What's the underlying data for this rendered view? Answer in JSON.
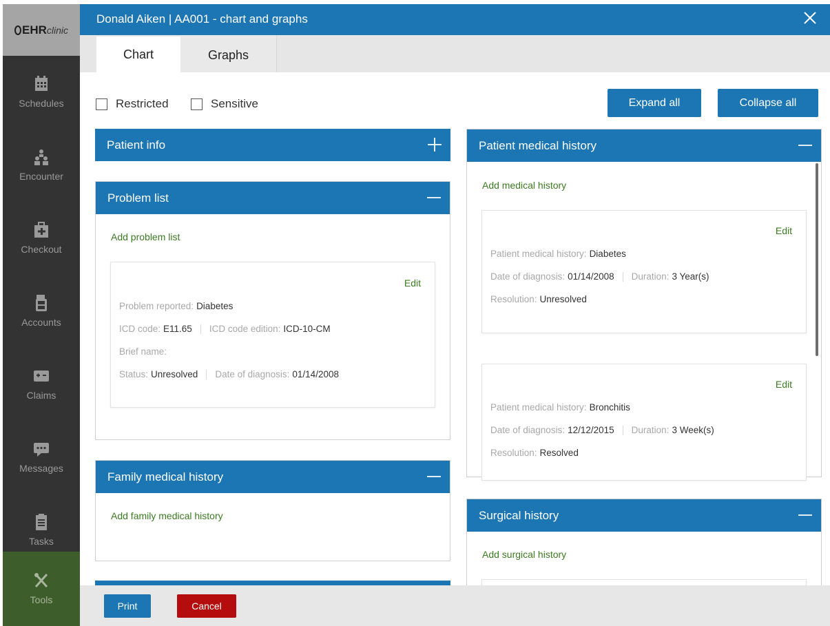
{
  "sidebar": {
    "logo": {
      "brand": "EHR",
      "suffix": "clinic"
    },
    "items": [
      {
        "label": "Schedules",
        "icon": "calendar-icon"
      },
      {
        "label": "Encounter",
        "icon": "users-icon"
      },
      {
        "label": "Checkout",
        "icon": "medical-bag-icon"
      },
      {
        "label": "Accounts",
        "icon": "calculator-icon"
      },
      {
        "label": "Claims",
        "icon": "claims-card-icon"
      },
      {
        "label": "Messages",
        "icon": "chat-bubble-icon"
      },
      {
        "label": "Tasks",
        "icon": "clipboard-icon"
      },
      {
        "label": "Tools",
        "icon": "tools-icon",
        "active": true
      }
    ]
  },
  "header": {
    "title": "Donald Aiken | AA001 - chart and graphs",
    "close_icon": "close-icon"
  },
  "tabs": [
    {
      "label": "Chart",
      "active": true
    },
    {
      "label": "Graphs",
      "active": false
    }
  ],
  "filters": {
    "restricted": "Restricted",
    "sensitive": "Sensitive"
  },
  "actions": {
    "expand_all": "Expand all",
    "collapse_all": "Collapse all"
  },
  "patient_info": {
    "title": "Patient info"
  },
  "problem_list": {
    "title": "Problem list",
    "add_link": "Add problem list",
    "card": {
      "edit": "Edit",
      "problem_reported_label": "Problem reported:",
      "problem_reported": "Diabetes",
      "icd_code_label": "ICD code:",
      "icd_code": "E11.65",
      "icd_edition_label": "ICD code edition:",
      "icd_edition": "ICD-10-CM",
      "brief_name_label": "Brief name:",
      "status_label": "Status:",
      "status": "Unresolved",
      "date_label": "Date of diagnosis:",
      "date": "01/14/2008"
    }
  },
  "family_history": {
    "title": "Family medical history",
    "add_link": "Add family medical history"
  },
  "medical_history": {
    "title": "Patient medical history",
    "add_link": "Add medical history",
    "cards": [
      {
        "edit": "Edit",
        "history_label": "Patient medical history:",
        "history": "Diabetes",
        "date_label": "Date of diagnosis:",
        "date": "01/14/2008",
        "duration_label": "Duration:",
        "duration": "3 Year(s)",
        "resolution_label": "Resolution:",
        "resolution": "Unresolved"
      },
      {
        "edit": "Edit",
        "history_label": "Patient medical history:",
        "history": "Bronchitis",
        "date_label": "Date of diagnosis:",
        "date": "12/12/2015",
        "duration_label": "Duration:",
        "duration": "3 Week(s)",
        "resolution_label": "Resolution:",
        "resolution": "Resolved"
      }
    ]
  },
  "surgical_history": {
    "title": "Surgical history",
    "add_link": "Add surgical history"
  },
  "footer": {
    "print": "Print",
    "cancel": "Cancel"
  },
  "colors": {
    "primary": "#1c76b3",
    "cancel": "#b50d0d",
    "link_green": "#3c7a22",
    "sidebar": "#333333",
    "active_nav": "#3d5e2a"
  }
}
